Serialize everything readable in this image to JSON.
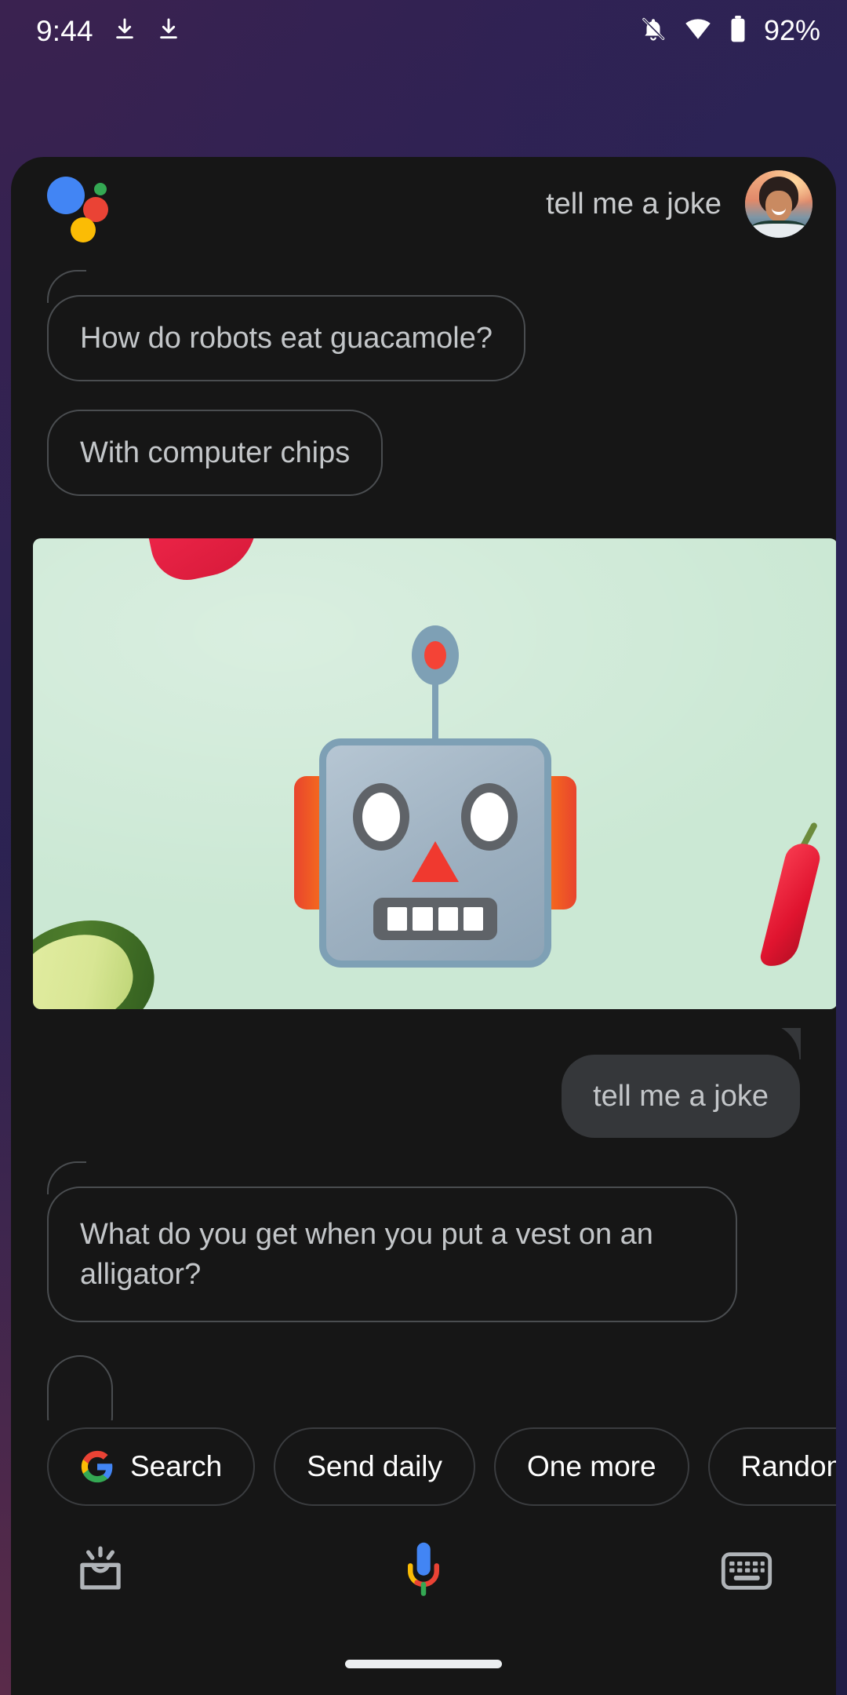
{
  "status_bar": {
    "time": "9:44",
    "battery_percent": "92%",
    "icons": [
      "download-icon",
      "download-icon",
      "notifications-off-icon",
      "wifi-icon",
      "battery-icon"
    ]
  },
  "assistant": {
    "logo_name": "google-assistant-logo",
    "header_query": "tell me a joke",
    "avatar_name": "user-avatar"
  },
  "conversation": [
    {
      "role": "assistant",
      "type": "text",
      "text": "How do robots eat guacamole?"
    },
    {
      "role": "assistant",
      "type": "text",
      "text": "With computer chips"
    },
    {
      "role": "assistant",
      "type": "image",
      "alt": "robot-face-guacamole-illustration"
    },
    {
      "role": "user",
      "type": "text",
      "text": "tell me a joke"
    },
    {
      "role": "assistant",
      "type": "text",
      "text": "What do you get when you put a vest on an alligator?"
    }
  ],
  "suggestion_chips": [
    {
      "label": "Search",
      "icon": "google-g-icon"
    },
    {
      "label": "Send daily",
      "icon": null
    },
    {
      "label": "One more",
      "icon": null
    },
    {
      "label": "Random",
      "icon": null
    }
  ],
  "bottom_bar": {
    "left_button": "snapshot-icon",
    "center_button": "google-mic-icon",
    "right_button": "keyboard-icon"
  },
  "colors": {
    "panel_bg": "#161616",
    "bubble_border": "#4a4d50",
    "bubble_text": "#c3c6c9",
    "user_bubble_bg": "#35373a",
    "chip_border": "#3a3c3f",
    "card_bg": "#cbe8d4",
    "google_blue": "#4285f4",
    "google_red": "#ea4335",
    "google_yellow": "#fbbc05",
    "google_green": "#34a853"
  }
}
